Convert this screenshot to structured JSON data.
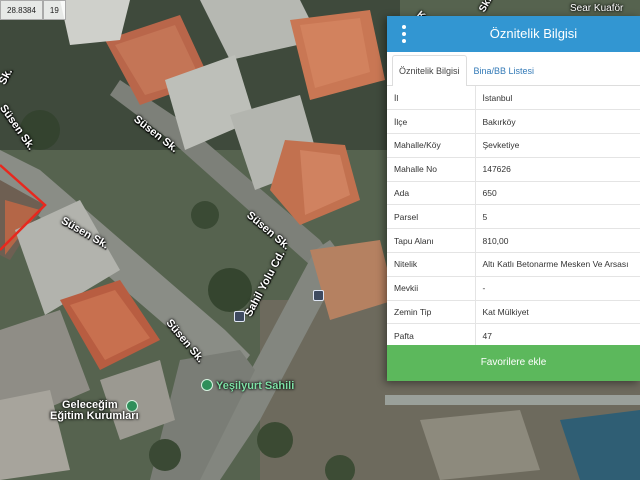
{
  "map": {
    "coordinates": [
      "28.8384",
      "19"
    ],
    "street_labels": [
      "Süsen Sk.",
      "Süsen Sk.",
      "Süsen Sk.",
      "Süsen Sk.",
      "Süsen Sk.",
      "Sahil Yolu Cd.",
      "Sahil Yolu Cd."
    ],
    "edge_labels": [
      "Sk.",
      "Kahiot",
      "Sk."
    ],
    "poi": {
      "beach": "Yeşilyurt Sahili",
      "school_line1": "Geleceğim",
      "school_line2": "Eğitim Kurumları",
      "shop": "Sear Kuaför"
    },
    "selected_parcel_color": "#e8281e"
  },
  "panel": {
    "title": "Öznitelik Bilgisi",
    "header_color": "#3296d2",
    "menu_icon": "kebab-menu-icon",
    "tabs": [
      {
        "label": "Öznitelik Bilgisi",
        "active": true
      },
      {
        "label": "Bina/BB Listesi",
        "active": false
      }
    ],
    "rows": [
      {
        "key": "İl",
        "value": "İstanbul"
      },
      {
        "key": "İlçe",
        "value": "Bakırköy"
      },
      {
        "key": "Mahalle/Köy",
        "value": "Şevketiye"
      },
      {
        "key": "Mahalle No",
        "value": "147626"
      },
      {
        "key": "Ada",
        "value": "650"
      },
      {
        "key": "Parsel",
        "value": "5"
      },
      {
        "key": "Tapu Alanı",
        "value": "810,00"
      },
      {
        "key": "Nitelik",
        "value": "Altı Katlı Betonarme Mesken Ve Arsası"
      },
      {
        "key": "Mevkii",
        "value": "-"
      },
      {
        "key": "Zemin Tip",
        "value": "Kat Mülkiyet"
      },
      {
        "key": "Pafta",
        "value": "47"
      }
    ],
    "favorite_button": "Favorilere ekle",
    "favorite_color": "#5cb85c"
  }
}
